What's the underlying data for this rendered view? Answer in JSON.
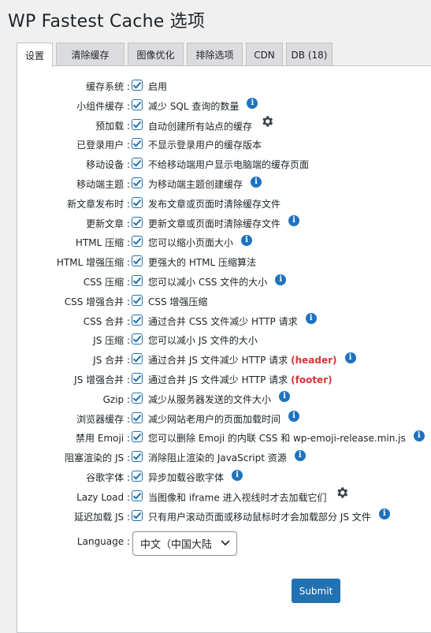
{
  "page": {
    "title": "WP Fastest Cache 选项"
  },
  "tabs": [
    {
      "label": "设置",
      "active": true
    },
    {
      "label": "清除缓存"
    },
    {
      "label": "图像优化"
    },
    {
      "label": "排除选项"
    },
    {
      "label": "CDN"
    },
    {
      "label": "DB (18)"
    }
  ],
  "settings": [
    {
      "label": "缓存系统 :",
      "desc": "启用",
      "checked": true
    },
    {
      "label": "小组件缓存 :",
      "desc": "减少 SQL 查询的数量",
      "checked": true,
      "icon": "info-icon"
    },
    {
      "label": "预加载 :",
      "desc": "自动创建所有站点的缓存",
      "checked": true,
      "icon": "gear-icon"
    },
    {
      "label": "已登录用户 :",
      "desc": "不显示登录用户的缓存版本",
      "checked": true
    },
    {
      "label": "移动设备 :",
      "desc": "不给移动端用户显示电脑端的缓存页面",
      "checked": true
    },
    {
      "label": "移动端主题 :",
      "desc": "为移动端主题创建缓存",
      "checked": true,
      "icon": "info-icon"
    },
    {
      "label": "新文章发布时 :",
      "desc": "发布文章或页面时清除缓存文件",
      "checked": true
    },
    {
      "label": "更新文章 :",
      "desc": "更新文章或页面时清除缓存文件",
      "checked": true,
      "icon": "info-icon"
    },
    {
      "label": "HTML 压缩 :",
      "desc": "您可以缩小页面大小",
      "checked": true,
      "icon": "info-icon"
    },
    {
      "label": "HTML 增强压缩 :",
      "desc": "更强大的 HTML 压缩算法",
      "checked": true
    },
    {
      "label": "CSS 压缩 :",
      "desc": "您可以减小 CSS 文件的大小",
      "checked": true,
      "icon": "info-icon"
    },
    {
      "label": "CSS 增强合并 :",
      "desc": "CSS 增强压缩",
      "checked": true
    },
    {
      "label": "CSS 合并 :",
      "desc": "通过合并 CSS 文件减少 HTTP 请求",
      "checked": true,
      "icon": "info-icon"
    },
    {
      "label": "JS 压缩 :",
      "desc": "您可以减小 JS 文件的大小",
      "checked": true
    },
    {
      "label": "JS 合并 :",
      "desc": "通过合并 JS 文件减少 HTTP 请求",
      "highlight": "(header)",
      "checked": true,
      "icon": "info-icon"
    },
    {
      "label": "JS 增强合并 :",
      "desc": " 通过合并 JS 文件减少 HTTP 请求",
      "highlight": "(footer)",
      "checked": true
    },
    {
      "label": "Gzip :",
      "desc": "减少从服务器发送的文件大小",
      "checked": true,
      "icon": "info-icon"
    },
    {
      "label": "浏览器缓存 :",
      "desc": "减少网站老用户的页面加载时间",
      "checked": true,
      "icon": "info-icon"
    },
    {
      "label": "禁用 Emoji :",
      "desc": "您可以删除 Emoji 的内联 CSS 和 wp-emoji-release.min.js",
      "checked": true,
      "icon": "info-icon"
    },
    {
      "label": "阻塞渲染的 JS :",
      "desc": "消除阻止渲染的 JavaScript 资源",
      "checked": true,
      "icon": "info-icon"
    },
    {
      "label": "谷歌字体 :",
      "desc": "异步加载谷歌字体",
      "checked": true,
      "icon": "info-icon"
    },
    {
      "label": "Lazy Load :",
      "desc": "当图像和 iframe 进入视线时才去加载它们",
      "checked": true,
      "icon": "gear-icon"
    },
    {
      "label": "延迟加载 JS :",
      "desc": "只有用户滚动页面或移动鼠标时才会加载部分 JS 文件",
      "checked": true,
      "icon": "info-icon"
    }
  ],
  "language": {
    "label": "Language :",
    "value": "中文（中国大陆"
  },
  "submit_label": "Submit",
  "colors": {
    "accent": "#2271b1",
    "info": "#1e73be",
    "highlight": "#d63638"
  }
}
